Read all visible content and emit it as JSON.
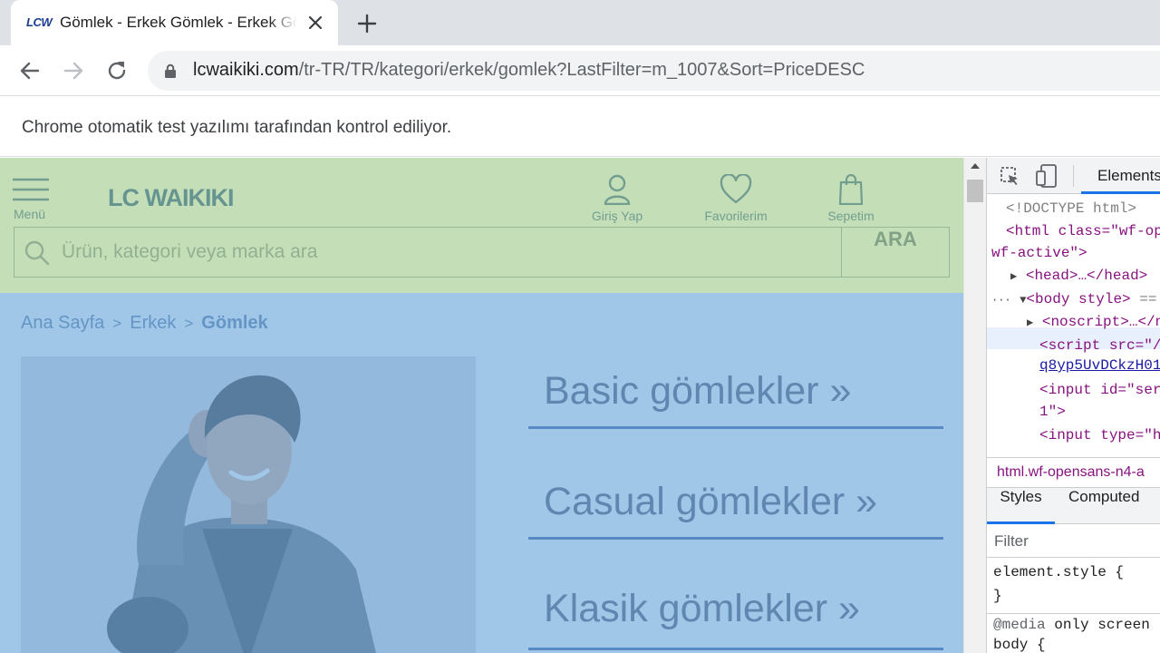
{
  "browser": {
    "tab": {
      "favicon": "LCW",
      "title": "Gömlek - Erkek Gömlek - Erkek Gömlek Modelleri"
    },
    "url_host": "lcwaikiki.com",
    "url_path": "/tr-TR/TR/kategori/erkek/gomlek?LastFilter=m_1007&Sort=PriceDESC",
    "infobar": "Chrome otomatik test yazılımı tarafından kontrol ediliyor."
  },
  "site": {
    "menu_label": "Menü",
    "logo_text": "LC WAIKIKI",
    "header": {
      "login": "Giriş Yap",
      "favorites": "Favorilerim",
      "cart": "Sepetim"
    },
    "search": {
      "placeholder": "Ürün, kategori veya marka ara",
      "button": "ARA"
    },
    "breadcrumb": {
      "home": "Ana Sayfa",
      "sep": ">",
      "men": "Erkek",
      "current": "Gömlek"
    },
    "categories": [
      {
        "label": "Basic gömlekler  »"
      },
      {
        "label": "Casual gömlekler  »"
      },
      {
        "label": "Klasik gömlekler  »"
      }
    ],
    "colors": {
      "header_highlight": "#93c47d",
      "body_highlight": "#6fa8dc",
      "link_underline": "#2b4f9a"
    }
  },
  "devtools": {
    "tab_elements": "Elements",
    "dom": {
      "doctype": "<!DOCTYPE html>",
      "html_open": "<html class=\"wf-op",
      "html_cont": "wf-active\">",
      "head": "<head>…</head>",
      "body_prefix": "···",
      "body": "<body style>",
      "body_eq": " ==",
      "noscript": "<noscript>…</n",
      "script": "<script src=\"/",
      "script_link": "q8yp5UvDCkzH01",
      "input1": "<input id=\"ser",
      "input1_cont": "1\">",
      "input2": "<input type=\"h"
    },
    "breadcrumb": "html.wf-opensans-n4-a",
    "styles_tabs": {
      "styles": "Styles",
      "computed": "Computed"
    },
    "filter_placeholder": "Filter",
    "rules": {
      "line1": "element.style {",
      "line2": "}",
      "media": "@media",
      "media_cont": " only screen",
      "body_rule": "body {"
    }
  }
}
